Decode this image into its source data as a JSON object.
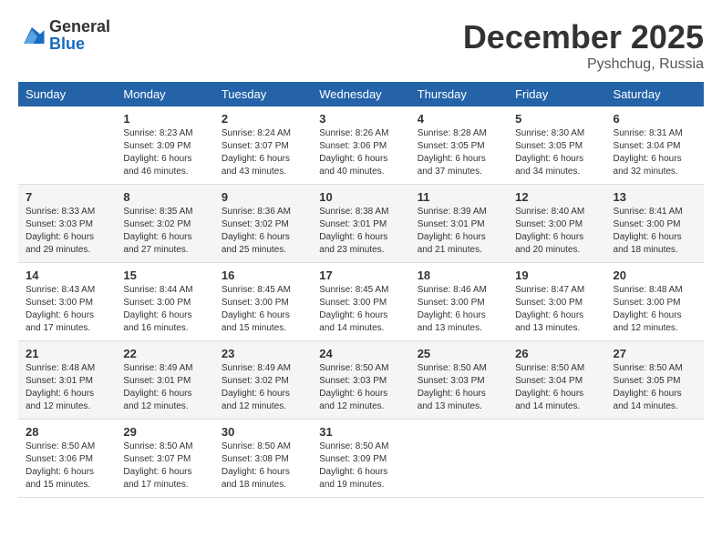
{
  "logo": {
    "general": "General",
    "blue": "Blue"
  },
  "title": "December 2025",
  "location": "Pyshchug, Russia",
  "days_of_week": [
    "Sunday",
    "Monday",
    "Tuesday",
    "Wednesday",
    "Thursday",
    "Friday",
    "Saturday"
  ],
  "weeks": [
    [
      {
        "day": "",
        "info": ""
      },
      {
        "day": "1",
        "info": "Sunrise: 8:23 AM\nSunset: 3:09 PM\nDaylight: 6 hours\nand 46 minutes."
      },
      {
        "day": "2",
        "info": "Sunrise: 8:24 AM\nSunset: 3:07 PM\nDaylight: 6 hours\nand 43 minutes."
      },
      {
        "day": "3",
        "info": "Sunrise: 8:26 AM\nSunset: 3:06 PM\nDaylight: 6 hours\nand 40 minutes."
      },
      {
        "day": "4",
        "info": "Sunrise: 8:28 AM\nSunset: 3:05 PM\nDaylight: 6 hours\nand 37 minutes."
      },
      {
        "day": "5",
        "info": "Sunrise: 8:30 AM\nSunset: 3:05 PM\nDaylight: 6 hours\nand 34 minutes."
      },
      {
        "day": "6",
        "info": "Sunrise: 8:31 AM\nSunset: 3:04 PM\nDaylight: 6 hours\nand 32 minutes."
      }
    ],
    [
      {
        "day": "7",
        "info": "Sunrise: 8:33 AM\nSunset: 3:03 PM\nDaylight: 6 hours\nand 29 minutes."
      },
      {
        "day": "8",
        "info": "Sunrise: 8:35 AM\nSunset: 3:02 PM\nDaylight: 6 hours\nand 27 minutes."
      },
      {
        "day": "9",
        "info": "Sunrise: 8:36 AM\nSunset: 3:02 PM\nDaylight: 6 hours\nand 25 minutes."
      },
      {
        "day": "10",
        "info": "Sunrise: 8:38 AM\nSunset: 3:01 PM\nDaylight: 6 hours\nand 23 minutes."
      },
      {
        "day": "11",
        "info": "Sunrise: 8:39 AM\nSunset: 3:01 PM\nDaylight: 6 hours\nand 21 minutes."
      },
      {
        "day": "12",
        "info": "Sunrise: 8:40 AM\nSunset: 3:00 PM\nDaylight: 6 hours\nand 20 minutes."
      },
      {
        "day": "13",
        "info": "Sunrise: 8:41 AM\nSunset: 3:00 PM\nDaylight: 6 hours\nand 18 minutes."
      }
    ],
    [
      {
        "day": "14",
        "info": "Sunrise: 8:43 AM\nSunset: 3:00 PM\nDaylight: 6 hours\nand 17 minutes."
      },
      {
        "day": "15",
        "info": "Sunrise: 8:44 AM\nSunset: 3:00 PM\nDaylight: 6 hours\nand 16 minutes."
      },
      {
        "day": "16",
        "info": "Sunrise: 8:45 AM\nSunset: 3:00 PM\nDaylight: 6 hours\nand 15 minutes."
      },
      {
        "day": "17",
        "info": "Sunrise: 8:45 AM\nSunset: 3:00 PM\nDaylight: 6 hours\nand 14 minutes."
      },
      {
        "day": "18",
        "info": "Sunrise: 8:46 AM\nSunset: 3:00 PM\nDaylight: 6 hours\nand 13 minutes."
      },
      {
        "day": "19",
        "info": "Sunrise: 8:47 AM\nSunset: 3:00 PM\nDaylight: 6 hours\nand 13 minutes."
      },
      {
        "day": "20",
        "info": "Sunrise: 8:48 AM\nSunset: 3:00 PM\nDaylight: 6 hours\nand 12 minutes."
      }
    ],
    [
      {
        "day": "21",
        "info": "Sunrise: 8:48 AM\nSunset: 3:01 PM\nDaylight: 6 hours\nand 12 minutes."
      },
      {
        "day": "22",
        "info": "Sunrise: 8:49 AM\nSunset: 3:01 PM\nDaylight: 6 hours\nand 12 minutes."
      },
      {
        "day": "23",
        "info": "Sunrise: 8:49 AM\nSunset: 3:02 PM\nDaylight: 6 hours\nand 12 minutes."
      },
      {
        "day": "24",
        "info": "Sunrise: 8:50 AM\nSunset: 3:03 PM\nDaylight: 6 hours\nand 12 minutes."
      },
      {
        "day": "25",
        "info": "Sunrise: 8:50 AM\nSunset: 3:03 PM\nDaylight: 6 hours\nand 13 minutes."
      },
      {
        "day": "26",
        "info": "Sunrise: 8:50 AM\nSunset: 3:04 PM\nDaylight: 6 hours\nand 14 minutes."
      },
      {
        "day": "27",
        "info": "Sunrise: 8:50 AM\nSunset: 3:05 PM\nDaylight: 6 hours\nand 14 minutes."
      }
    ],
    [
      {
        "day": "28",
        "info": "Sunrise: 8:50 AM\nSunset: 3:06 PM\nDaylight: 6 hours\nand 15 minutes."
      },
      {
        "day": "29",
        "info": "Sunrise: 8:50 AM\nSunset: 3:07 PM\nDaylight: 6 hours\nand 17 minutes."
      },
      {
        "day": "30",
        "info": "Sunrise: 8:50 AM\nSunset: 3:08 PM\nDaylight: 6 hours\nand 18 minutes."
      },
      {
        "day": "31",
        "info": "Sunrise: 8:50 AM\nSunset: 3:09 PM\nDaylight: 6 hours\nand 19 minutes."
      },
      {
        "day": "",
        "info": ""
      },
      {
        "day": "",
        "info": ""
      },
      {
        "day": "",
        "info": ""
      }
    ]
  ]
}
